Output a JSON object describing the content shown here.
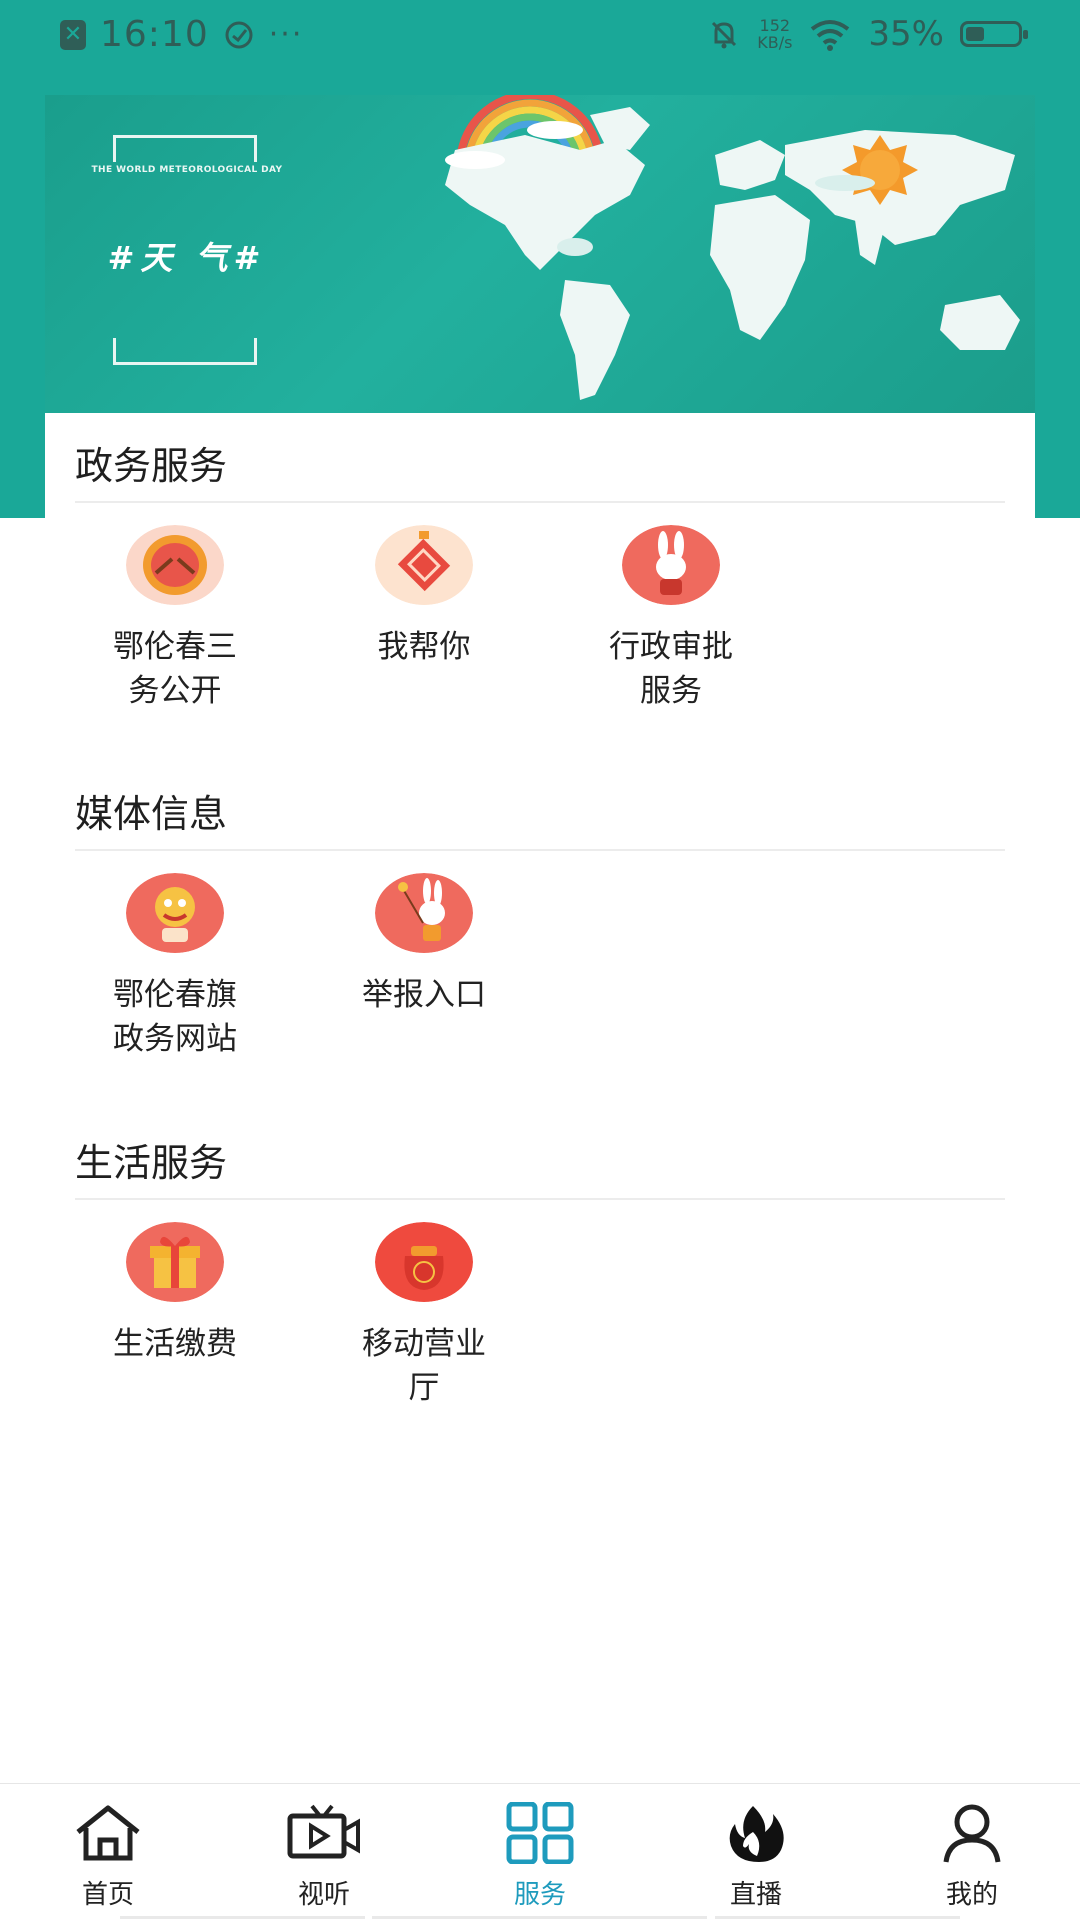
{
  "status_bar": {
    "time": "16:10",
    "dots": "···",
    "net_speed_value": "152",
    "net_speed_unit": "KB/s",
    "battery": "35%",
    "battery_level": 0.35
  },
  "banner": {
    "subtitle_en": "THE WORLD METEOROLOGICAL DAY",
    "title": "#天 气#"
  },
  "sections": [
    {
      "title": "政务服务",
      "items": [
        {
          "label": "鄂伦春三务公开",
          "icon": "drum-icon"
        },
        {
          "label": "我帮你",
          "icon": "chinese-knot-icon"
        },
        {
          "label": "行政审批服务",
          "icon": "rabbit-icon"
        }
      ]
    },
    {
      "title": "媒体信息",
      "items": [
        {
          "label": "鄂伦春旗政务网站",
          "icon": "lion-dance-icon"
        },
        {
          "label": "举报入口",
          "icon": "rabbit-lantern-icon"
        }
      ]
    },
    {
      "title": "生活服务",
      "items": [
        {
          "label": "生活缴费",
          "icon": "gift-box-icon"
        },
        {
          "label": "移动营业厅",
          "icon": "lucky-bag-icon"
        }
      ]
    }
  ],
  "bottom_nav": {
    "active": "服务",
    "items": [
      {
        "label": "首页",
        "icon": "home-icon"
      },
      {
        "label": "视听",
        "icon": "tv-video-icon"
      },
      {
        "label": "服务",
        "icon": "grid-icon"
      },
      {
        "label": "直播",
        "icon": "flame-icon"
      },
      {
        "label": "我的",
        "icon": "user-icon"
      }
    ]
  },
  "colors": {
    "brand_teal": "#1aa898",
    "active_tab": "#1e9bbd",
    "icon_red": "#e8554a"
  }
}
